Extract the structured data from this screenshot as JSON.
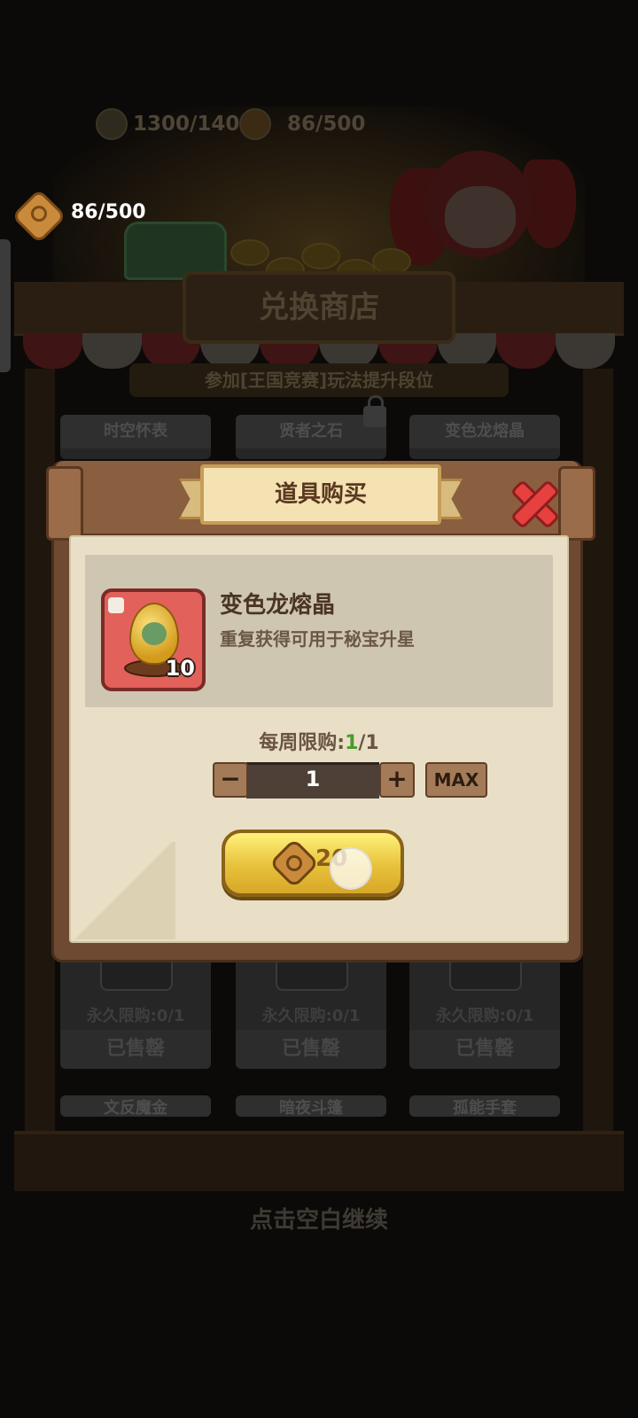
{
  "background": {
    "top_resources": [
      {
        "icon": "energy-icon",
        "value": "1300/1400"
      },
      {
        "icon": "coin-icon",
        "value": "86/500"
      }
    ],
    "currency": {
      "icon": "dragon-coin-icon",
      "value": "86/500"
    },
    "shop_title": "兑换商店",
    "rank_hint": "参加[王国竞赛]玩法提升段位",
    "cards_top": [
      "时空怀表",
      "贤者之石",
      "变色龙熔晶"
    ],
    "cards_middle": [
      {
        "limit": "永久限购:0/1",
        "status": "已售罄"
      },
      {
        "limit": "永久限购:0/1",
        "status": "已售罄"
      },
      {
        "limit": "永久限购:0/1",
        "status": "已售罄"
      }
    ],
    "cards_bottom": [
      "文反魔金",
      "暗夜斗篷",
      "孤能手套"
    ],
    "continue_hint": "点击空白继续"
  },
  "modal": {
    "title": "道具购买",
    "item": {
      "name": "变色龙熔晶",
      "description": "重复获得可用于秘宝升星",
      "count": "10",
      "icon": "chameleon-egg-icon"
    },
    "weekly_limit_label": "每周限购:",
    "weekly_limit_current": "1",
    "weekly_limit_sep_total": "/1",
    "quantity": "1",
    "minus_label": "−",
    "plus_label": "+",
    "max_label": "MAX",
    "price": "20",
    "price_icon": "dragon-coin-icon"
  },
  "colors": {
    "parchment": "#e9dfc7",
    "wood": "#8a5f3f",
    "buy_button": "#e7c13a",
    "close": "#e6413f",
    "limit_highlight": "#4a9a2c"
  }
}
